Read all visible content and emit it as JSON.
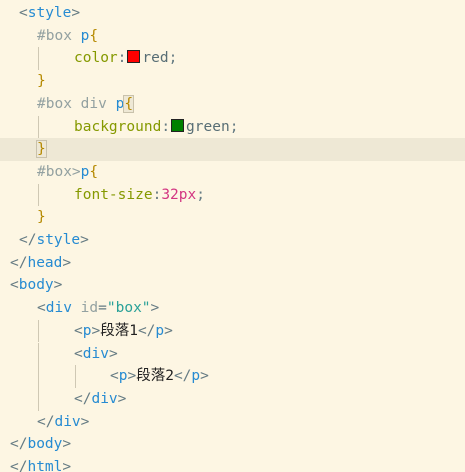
{
  "editor": {
    "language": "html",
    "colors": {
      "background": "#fdf6e3",
      "current_line": "#eee8d5",
      "tag": "#268bd2",
      "property": "#859900",
      "number": "#d33682",
      "swatch_red": "#ff0000",
      "swatch_green": "#008000"
    },
    "lines": {
      "l1": {
        "open": "<",
        "tag": "style",
        "close": ">"
      },
      "l2": {
        "sel": "#box ",
        "elem": "p",
        "brace": "{"
      },
      "l3": {
        "prop": "color",
        "colon": ":",
        "value": "red",
        "semi": ";"
      },
      "l4": {
        "brace": "}"
      },
      "l5": {
        "sel": "#box div ",
        "elem": "p",
        "brace": "{"
      },
      "l6": {
        "prop": "background",
        "colon": ":",
        "value": "green",
        "semi": ";"
      },
      "l7": {
        "brace": "}"
      },
      "l8": {
        "sel": "#box>",
        "elem": "p",
        "brace": "{"
      },
      "l9": {
        "prop": "font-size",
        "colon": ":",
        "number": "32",
        "unit": "px",
        "semi": ";"
      },
      "l10": {
        "brace": "}"
      },
      "l11": {
        "open": "</",
        "tag": "style",
        "close": ">"
      },
      "l12": {
        "open": "</",
        "tag": "head",
        "close": ">"
      },
      "l13": {
        "open": "<",
        "tag": "body",
        "close": ">"
      },
      "l14": {
        "open": "<",
        "tag": "div",
        "space": " ",
        "attr": "id",
        "eq": "=",
        "str": "\"box\"",
        "close": ">"
      },
      "l15": {
        "open": "<",
        "tag": "p",
        "close": ">",
        "text": "段落1",
        "open2": "</",
        "tag2": "p",
        "close2": ">"
      },
      "l16": {
        "open": "<",
        "tag": "div",
        "close": ">"
      },
      "l17": {
        "open": "<",
        "tag": "p",
        "close": ">",
        "text": "段落2",
        "open2": "</",
        "tag2": "p",
        "close2": ">"
      },
      "l18": {
        "open": "</",
        "tag": "div",
        "close": ">"
      },
      "l19": {
        "open": "</",
        "tag": "div",
        "close": ">"
      },
      "l20": {
        "open": "</",
        "tag": "body",
        "close": ">"
      },
      "l21": {
        "open": "</",
        "tag": "html",
        "close": ">"
      }
    }
  }
}
